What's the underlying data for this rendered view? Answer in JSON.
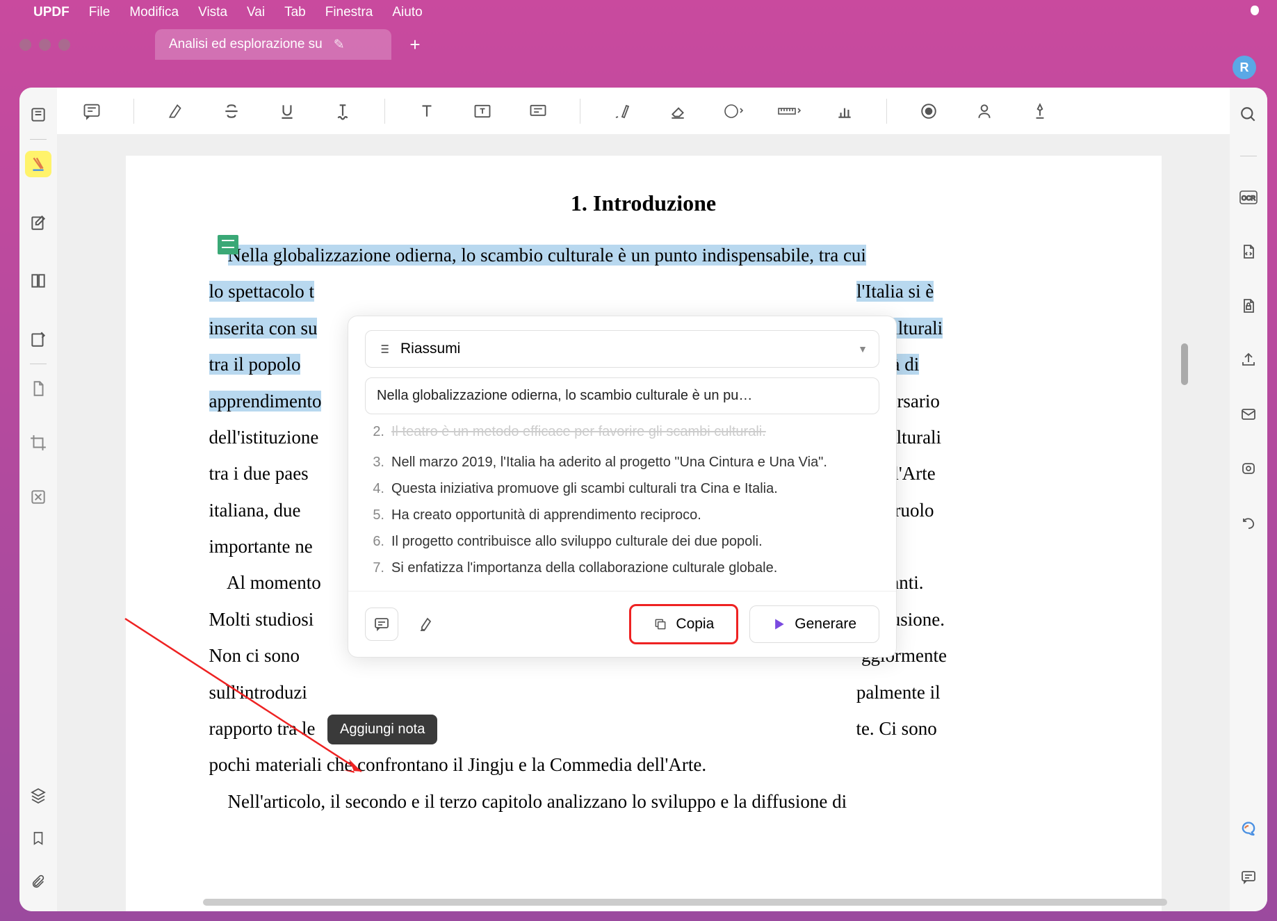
{
  "menubar": {
    "app": "UPDF",
    "items": [
      "File",
      "Modifica",
      "Vista",
      "Vai",
      "Tab",
      "Finestra",
      "Aiuto"
    ]
  },
  "tab": {
    "title": "Analisi ed esplorazione su"
  },
  "avatar": "R",
  "doc": {
    "heading": "1. Introduzione",
    "hl1": "Nella globalizzazione odierna, lo scambio culturale è un punto indispensabile, tra cui",
    "l2a": "lo spettacolo t",
    "l2b": "l'Italia si è",
    "l3a": "inserita con su",
    "l3b": "bi culturali",
    "l4a": "tra il popolo",
    "l4b": "ssibilità di",
    "l5a": "apprendimento",
    "l5b": "nniversario",
    "t6": "dell'istituzione",
    "t6b": "bi culturali",
    "t7": "tra i due paes",
    "t7b": "a dell'Arte",
    "t8": "italiana, due",
    "t8b": "o un ruolo",
    "t9": "importante ne",
    "t10a": "    Al momento",
    "t10b": "abbondanti.",
    "t11": "Molti studiosi",
    "t11b": "diffusione.",
    "t12": "Non ci sono",
    "t12b": "ggiormente",
    "t13": "sull'introduzi",
    "t13b": "palmente il",
    "t14": "rapporto tra le",
    "t14b": "te. Ci sono",
    "t15": "pochi materiali che confrontano il Jingju e la Commedia dell'Arte.",
    "t16": "    Nell'articolo, il secondo e il terzo capitolo analizzano lo sviluppo e la diffusione di"
  },
  "popup": {
    "mode": "Riassumi",
    "input": "Nella globalizzazione odierna, lo scambio culturale è un pu…",
    "items": [
      {
        "n": "2.",
        "cut": true,
        "text": "Il teatro è un metodo efficace per favorire gli scambi culturali."
      },
      {
        "n": "3.",
        "text": "Nell marzo 2019, l'Italia ha aderito al progetto \"Una Cintura e Una Via\"."
      },
      {
        "n": "4.",
        "text": "Questa iniziativa promuove gli scambi culturali tra Cina e Italia."
      },
      {
        "n": "5.",
        "text": "Ha creato opportunità di apprendimento reciproco."
      },
      {
        "n": "6.",
        "text": "Il progetto contribuisce allo sviluppo culturale dei due popoli."
      },
      {
        "n": "7.",
        "text": "Si enfatizza l'importanza della collaborazione culturale globale."
      }
    ],
    "copy": "Copia",
    "generate": "Generare"
  },
  "tooltip": "Aggiungi nota"
}
